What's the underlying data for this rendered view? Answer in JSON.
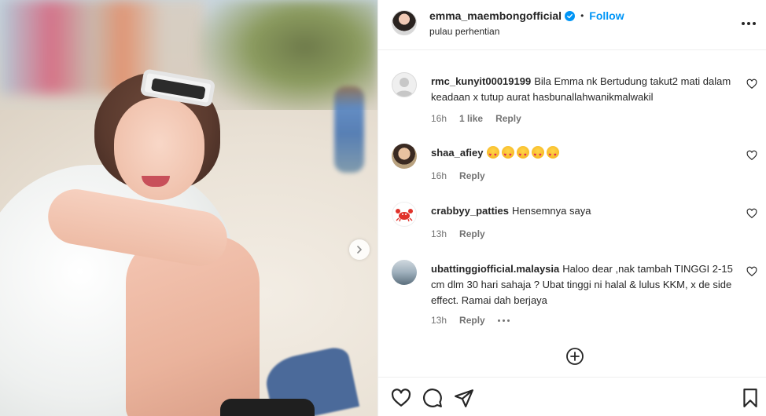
{
  "post": {
    "username": "emma_maembongofficial",
    "location": "pulau perhentian",
    "follow_label": "Follow",
    "separator": "•",
    "verified": true
  },
  "comments": [
    {
      "username": "rmc_kunyit00019199",
      "text": "Bila Emma nk Bertudung takut2 mati dalam keadaan x tutup aurat hasbunallahwanikmalwakil",
      "time": "16h",
      "likes": "1 like",
      "reply_label": "Reply",
      "avatar": "default-avatar"
    },
    {
      "username": "shaa_afiey",
      "text": "",
      "emoji_count": 5,
      "emoji_name": "heart-eyes-emoji",
      "time": "16h",
      "reply_label": "Reply",
      "avatar": "photo-avatar"
    },
    {
      "username": "crabbyy_patties",
      "text": "Hensemnya saya",
      "time": "13h",
      "reply_label": "Reply",
      "avatar": "crab-avatar"
    },
    {
      "username": "ubattinggiofficial.malaysia",
      "text": "Haloo dear ,nak tambah TINGGI 2-15 cm dlm 30 hari sahaja ? Ubat tinggi ni halal & lulus KKM, x de side effect. Ramai dah berjaya",
      "time": "13h",
      "reply_label": "Reply",
      "avatar": "photo-avatar"
    }
  ],
  "icons": {
    "like": "heart-icon",
    "comment": "comment-icon",
    "share": "share-icon",
    "save": "bookmark-icon",
    "more": "more-horizontal-icon",
    "load_more": "plus-circle-icon",
    "carousel_next": "chevron-right-icon"
  },
  "colors": {
    "accent": "#0095f6",
    "text": "#262626",
    "secondary": "#737373",
    "border": "#efefef"
  }
}
